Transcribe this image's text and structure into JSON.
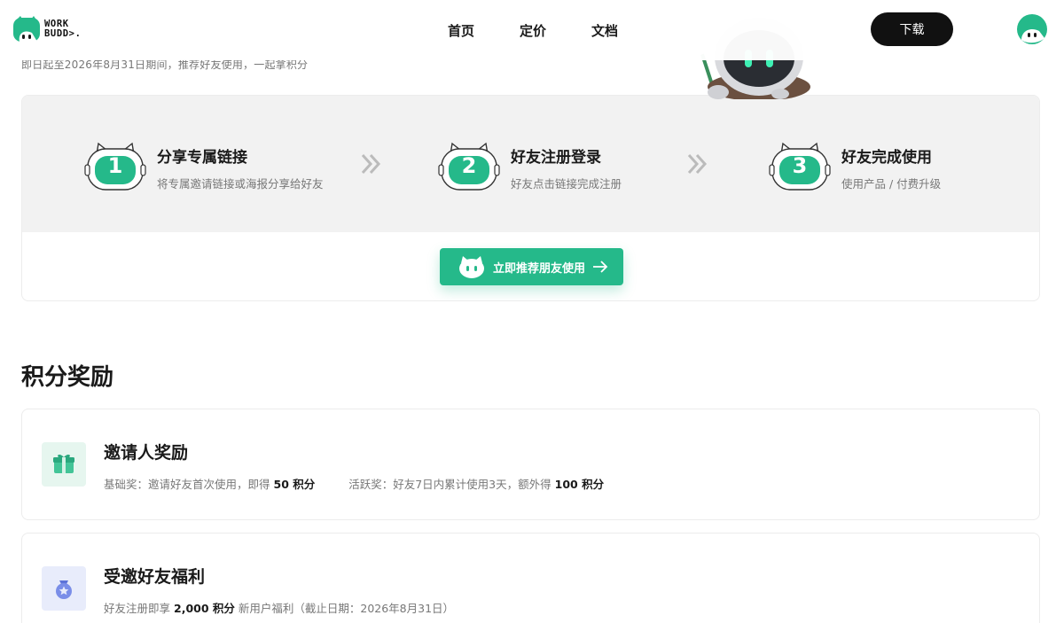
{
  "header": {
    "logo_line1": "WORK",
    "logo_line2": "BUDD>.",
    "nav": [
      "首页",
      "定价",
      "文档"
    ],
    "download_label": "下载"
  },
  "subline": "即日起至2026年8月31日期间，推荐好友使用，一起拿积分",
  "steps": [
    {
      "number": "1",
      "title": "分享专属链接",
      "desc": "将专属邀请链接或海报分享给好友"
    },
    {
      "number": "2",
      "title": "好友注册登录",
      "desc": "好友点击链接完成注册"
    },
    {
      "number": "3",
      "title": "好友完成使用",
      "desc": "使用产品 / 付费升级"
    }
  ],
  "cta_label": "立即推荐朋友使用",
  "section_title": "积分奖励",
  "rewards": {
    "inviter": {
      "title": "邀请人奖励",
      "basic_prefix": "基础奖：邀请好友首次使用，即得",
      "basic_value": "50 积分",
      "active_prefix": "活跃奖：好友7日内累计使用3天，额外得",
      "active_value": "100 积分"
    },
    "invitee": {
      "title": "受邀好友福利",
      "prefix": "好友注册即享",
      "value": "2,000 积分",
      "suffix": "新用户福利（截止日期：2026年8月31日）"
    }
  },
  "colors": {
    "brand_green": "#25b98a",
    "dark_button": "#111111",
    "band_gray": "#f2f2f2"
  },
  "icons": {
    "logo": "robot-head-logo",
    "avatar": "robot-avatar",
    "step": "cat-robot-badge",
    "separator": "double-chevron-right",
    "cta": "cat-face",
    "arrow": "arrow-right",
    "inviter": "gift-box",
    "invitee": "star-bag"
  }
}
